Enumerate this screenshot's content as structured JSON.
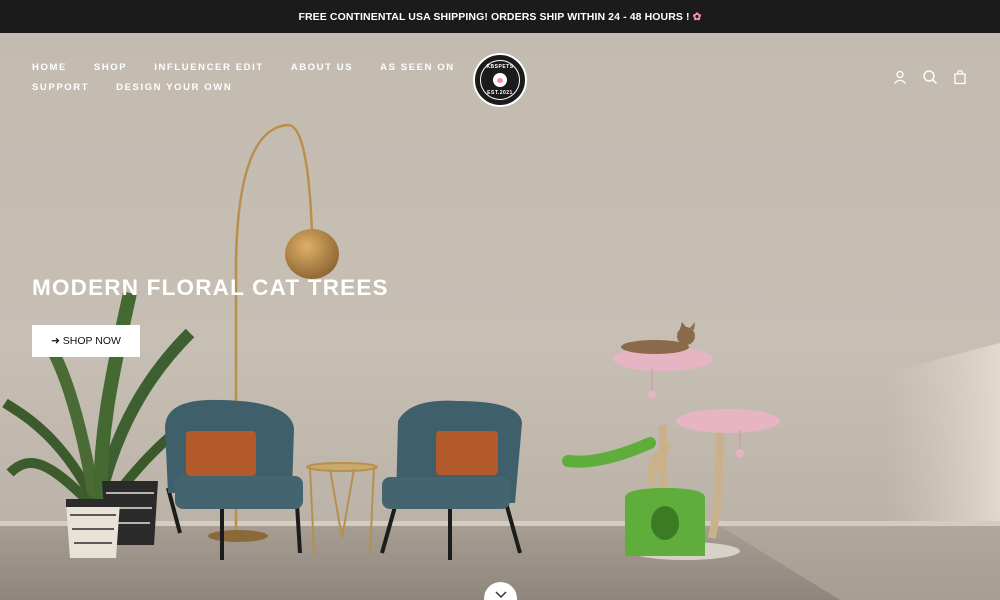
{
  "announcement": {
    "text": "FREE CONTINENTAL USA SHIPPING! ORDERS SHIP WITHIN 24 - 48 HOURS !",
    "flower_glyph": "✿"
  },
  "nav": {
    "row1": [
      "HOME",
      "SHOP",
      "INFLUENCER EDIT",
      "ABOUT US",
      "AS SEEN ON"
    ],
    "row2": [
      "SUPPORT",
      "DESIGN YOUR OWN"
    ]
  },
  "logo": {
    "top_text": "KBSPETS",
    "bottom_text": "EST.2021"
  },
  "icons": {
    "account": "account-icon",
    "search": "search-icon",
    "cart": "cart-icon"
  },
  "hero": {
    "title": "MODERN FLORAL CAT TREES",
    "button_label": "➜ SHOP NOW"
  },
  "colors": {
    "announcement_bg": "#1b1b1b",
    "chair_teal": "#3f5f6b",
    "cushion_rust": "#b35a2a",
    "flower_pink": "#e7b4c3",
    "cat_tree_green": "#5fae3c"
  }
}
